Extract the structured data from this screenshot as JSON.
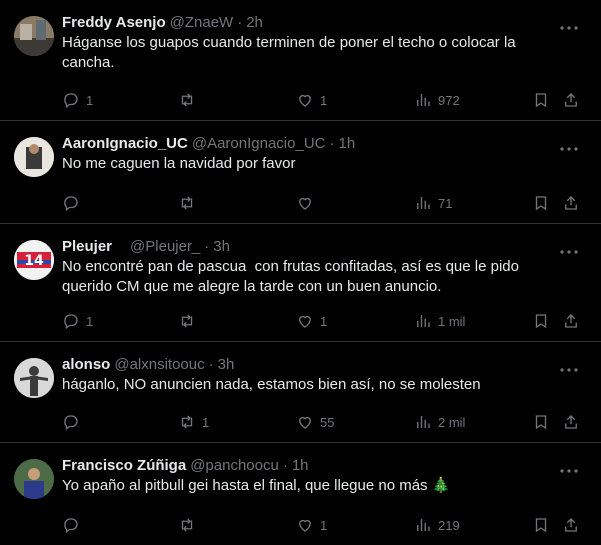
{
  "tweets": [
    {
      "name": "Freddy Asenjo",
      "handle": "@ZnaeW",
      "dot": "·",
      "time": "2h",
      "text": "Háganse los guapos cuando terminen de poner el techo o colocar la cancha.",
      "replies": "1",
      "retweets": "",
      "likes": "1",
      "views": "972"
    },
    {
      "name": "AaronIgnacio_UC",
      "handle": "@AaronIgnacio_UC",
      "dot": "·",
      "time": "1h",
      "text": "No me caguen la navidad por favor",
      "replies": "",
      "retweets": "",
      "likes": "",
      "views": "71"
    },
    {
      "name": "Pleujer",
      "handle": "@Pleujer_",
      "dot": "·",
      "time": "3h",
      "text": "No encontré pan de pascua  con frutas confitadas, así es que le pido querido CM que me alegre la tarde con un buen anuncio.",
      "replies": "1",
      "retweets": "",
      "likes": "1",
      "views": "1 mil"
    },
    {
      "name": "alonso",
      "handle": "@alxnsitoouc",
      "dot": "·",
      "time": "3h",
      "text": "háganlo, NO anuncien nada, estamos bien así, no se molesten",
      "replies": "",
      "retweets": "1",
      "likes": "55",
      "views": "2 mil"
    },
    {
      "name": "Francisco Zúñiga",
      "handle": "@panchoocu",
      "dot": "·",
      "time": "1h",
      "text": "Yo apaño al pitbull gei hasta el final, que llegue no más 🎄",
      "replies": "",
      "retweets": "",
      "likes": "1",
      "views": "219"
    }
  ],
  "icons": {
    "reply": "reply-icon",
    "retweet": "retweet-icon",
    "like": "heart-icon",
    "views": "views-icon",
    "bookmark": "bookmark-icon",
    "share": "share-icon",
    "more": "more-icon"
  },
  "colors": {
    "background": "#000000",
    "text": "#e7e9ea",
    "secondary": "#71767b",
    "divider": "#2f3336"
  }
}
